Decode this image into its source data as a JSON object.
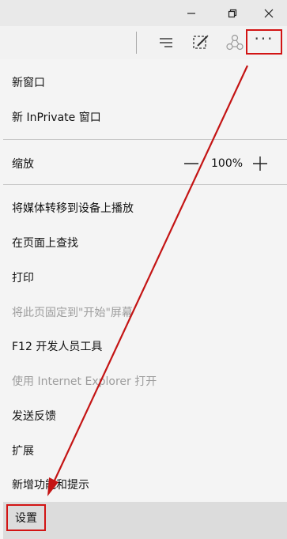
{
  "window": {
    "minimize_glyph": "—",
    "icons": [
      "minimize-icon",
      "restore-icon",
      "close-icon"
    ]
  },
  "toolbar": {
    "more_glyph": "···",
    "icons": [
      "hub-icon",
      "web-note-icon",
      "share-icon",
      "more-actions-icon"
    ]
  },
  "menu": {
    "new_window": "新窗口",
    "new_inprivate": "新 InPrivate 窗口",
    "zoom_label": "缩放",
    "zoom_value": "100%",
    "cast_media": "将媒体转移到设备上播放",
    "find_on_page": "在页面上查找",
    "print": "打印",
    "pin_to_start": "将此页固定到\"开始\"屏幕",
    "f12_tools": "F12 开发人员工具",
    "open_with_ie": "使用 Internet Explorer 打开",
    "send_feedback": "发送反馈",
    "extensions": "扩展",
    "whats_new": "新增功能和提示",
    "settings": "设置"
  },
  "colors": {
    "highlight": "#d21414",
    "menu_bg": "#f4f4f4",
    "titlebar_bg": "#e9e9e9",
    "disabled_text": "#9d9d9d"
  }
}
